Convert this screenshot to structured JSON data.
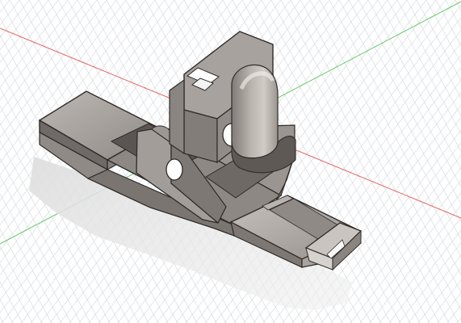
{
  "viewport": {
    "background": "#ffffff",
    "grid_color": "#cfd4da",
    "axis_colors": {
      "x_axis": "#e25b5b",
      "y_axis": "#64c864"
    }
  },
  "model": {
    "material_colors": {
      "base": "#8f8a86",
      "light": "#c8c4c0",
      "mid": "#a29d99",
      "dark": "#5c5753",
      "edge": "#2f2b28",
      "shadow": "#d9d9d9"
    }
  }
}
